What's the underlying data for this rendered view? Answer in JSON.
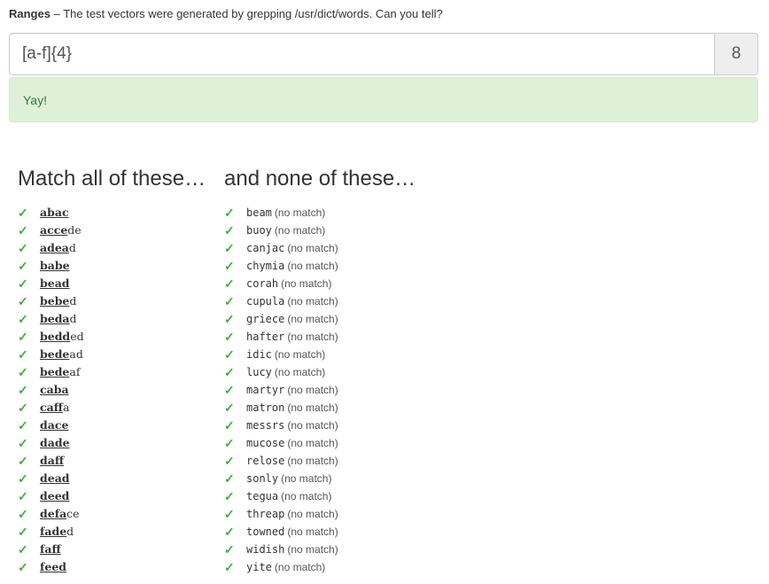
{
  "header": {
    "title": "Ranges",
    "description": "– The test vectors were generated by grepping /usr/dict/words. Can you tell?"
  },
  "regex": {
    "value": "[a-f]{4}",
    "score": "8"
  },
  "alert": {
    "message": "Yay!"
  },
  "match": {
    "heading": "Match all of these…",
    "items": [
      {
        "hl": "abac",
        "rest": ""
      },
      {
        "hl": "acce",
        "rest": "de"
      },
      {
        "hl": "adea",
        "rest": "d"
      },
      {
        "hl": "babe",
        "rest": ""
      },
      {
        "hl": "bead",
        "rest": ""
      },
      {
        "hl": "bebe",
        "rest": "d"
      },
      {
        "hl": "beda",
        "rest": "d"
      },
      {
        "hl": "bedd",
        "rest": "ed"
      },
      {
        "hl": "bede",
        "rest": "ad"
      },
      {
        "hl": "bede",
        "rest": "af"
      },
      {
        "hl": "caba",
        "rest": ""
      },
      {
        "hl": "caff",
        "rest": "a"
      },
      {
        "hl": "dace",
        "rest": ""
      },
      {
        "hl": "dade",
        "rest": ""
      },
      {
        "hl": "daff",
        "rest": ""
      },
      {
        "hl": "dead",
        "rest": ""
      },
      {
        "hl": "deed",
        "rest": ""
      },
      {
        "hl": "defa",
        "rest": "ce"
      },
      {
        "hl": "fade",
        "rest": "d"
      },
      {
        "hl": "faff",
        "rest": ""
      },
      {
        "hl": "feed",
        "rest": ""
      }
    ]
  },
  "nomatch": {
    "heading": "and none of these…",
    "status_label": "(no match)",
    "items": [
      "beam",
      "buoy",
      "canjac",
      "chymia",
      "corah",
      "cupula",
      "griece",
      "hafter",
      "idic",
      "lucy",
      "martyr",
      "matron",
      "messrs",
      "mucose",
      "relose",
      "sonly",
      "tegua",
      "threap",
      "towned",
      "widish",
      "yite"
    ]
  },
  "icons": {
    "check": "✓"
  },
  "colors": {
    "check": "#3cb23c",
    "alert_bg": "#dff0d8",
    "alert_text": "#3c763d"
  }
}
